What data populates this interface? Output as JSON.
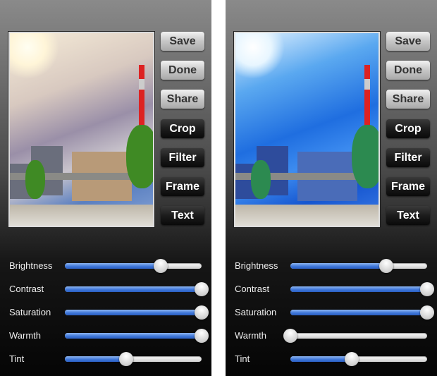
{
  "panels": [
    {
      "buttons": [
        {
          "label": "Save",
          "style": "light"
        },
        {
          "label": "Done",
          "style": "light"
        },
        {
          "label": "Share",
          "style": "light"
        },
        {
          "label": "Crop",
          "style": "dark"
        },
        {
          "label": "Filter",
          "style": "dark"
        },
        {
          "label": "Frame",
          "style": "dark"
        },
        {
          "label": "Text",
          "style": "dark"
        }
      ],
      "photo_tone": "warm",
      "sliders": [
        {
          "label": "Brightness",
          "value": 0.7
        },
        {
          "label": "Contrast",
          "value": 1.0
        },
        {
          "label": "Saturation",
          "value": 1.0
        },
        {
          "label": "Warmth",
          "value": 1.0
        },
        {
          "label": "Tint",
          "value": 0.45
        }
      ]
    },
    {
      "buttons": [
        {
          "label": "Save",
          "style": "light"
        },
        {
          "label": "Done",
          "style": "light"
        },
        {
          "label": "Share",
          "style": "light"
        },
        {
          "label": "Crop",
          "style": "dark"
        },
        {
          "label": "Filter",
          "style": "dark"
        },
        {
          "label": "Frame",
          "style": "dark"
        },
        {
          "label": "Text",
          "style": "dark"
        }
      ],
      "photo_tone": "cool",
      "sliders": [
        {
          "label": "Brightness",
          "value": 0.7
        },
        {
          "label": "Contrast",
          "value": 1.0
        },
        {
          "label": "Saturation",
          "value": 1.0
        },
        {
          "label": "Warmth",
          "value": 0.0
        },
        {
          "label": "Tint",
          "value": 0.45
        }
      ]
    }
  ],
  "colors": {
    "slider_fill": "#3c74d8",
    "background_top": "#8a8a8a",
    "background_bottom": "#050505"
  }
}
